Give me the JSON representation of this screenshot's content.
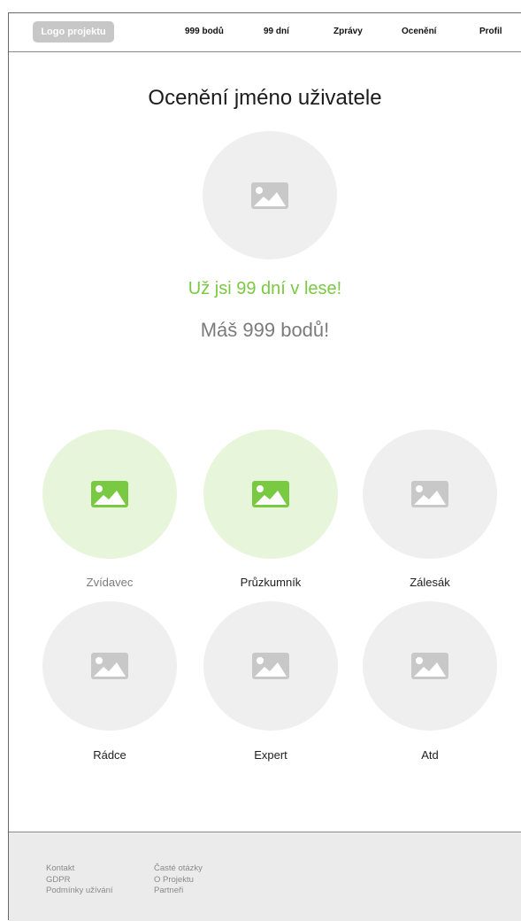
{
  "header": {
    "logo": "Logo projektu",
    "nav": [
      "999 bodů",
      "99 dní",
      "Zprávy",
      "Ocenění",
      "Profil"
    ]
  },
  "main": {
    "title": "Ocenění jméno uživatele",
    "days_message": "Už jsi 99 dní v lese!",
    "points_message": "Máš 999 bodů!"
  },
  "badges": [
    {
      "label": "Zvídavec",
      "earned": true
    },
    {
      "label": "Průzkumník",
      "earned": true
    },
    {
      "label": "Zálesák",
      "earned": false
    },
    {
      "label": "Rádce",
      "earned": false
    },
    {
      "label": "Expert",
      "earned": false
    },
    {
      "label": "Atd",
      "earned": false
    }
  ],
  "footer": {
    "col1": [
      "Kontakt",
      "GDPR",
      "Podmínky užívání"
    ],
    "col2": [
      "Časté otázky",
      "O Projektu",
      "Partneři"
    ]
  },
  "colors": {
    "accent_green": "#7ac943",
    "earned_bg": "#e7f5db",
    "placeholder_bg": "#efefef"
  }
}
